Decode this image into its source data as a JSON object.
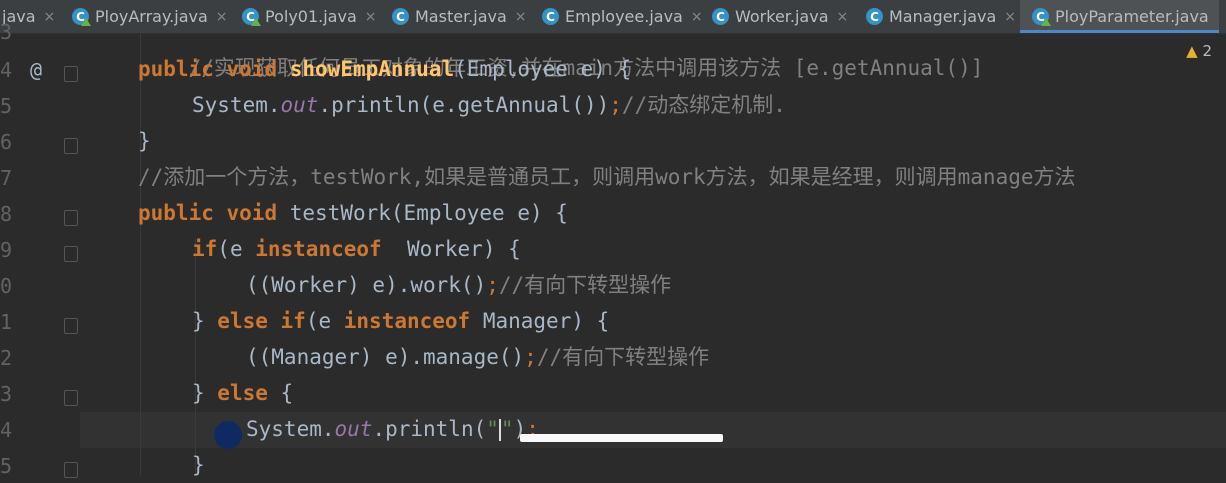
{
  "tabs": [
    {
      "label": "java",
      "icon": "none"
    },
    {
      "label": "PloyArray.java",
      "icon": "class-run-icon"
    },
    {
      "label": "Poly01.java",
      "icon": "class-run-icon"
    },
    {
      "label": "Master.java",
      "icon": "class-icon"
    },
    {
      "label": "Employee.java",
      "icon": "class-icon"
    },
    {
      "label": "Worker.java",
      "icon": "class-icon"
    },
    {
      "label": "Manager.java",
      "icon": "class-icon"
    },
    {
      "label": "PloyParameter.java",
      "icon": "class-run-icon",
      "active": true
    }
  ],
  "close_glyph": "×",
  "inspections": {
    "count": "2"
  },
  "gutter": {
    "line_numbers": [
      "3",
      "4",
      "5",
      "6",
      "7",
      "8",
      "9",
      "0",
      "1",
      "2",
      "3",
      "4",
      "5"
    ],
    "annotation": "@"
  },
  "code": {
    "line0_comment": "//实现获取任何员工对象的年工资,并在main方法中调用该方法 [e.getAnnual()]",
    "line1": {
      "kw1": "public",
      "kw2": "void",
      "name": "showEmpAnnual",
      "sig": "(Employee e) {"
    },
    "line2": {
      "a": "System.",
      "field": "out",
      "b": ".println(e.getAnnual())",
      "semi": ";",
      "comment": "//动态绑定机制."
    },
    "line3": "}",
    "line4_comment": "//添加一个方法，testWork,如果是普通员工，则调用work方法，如果是经理，则调用manage方法",
    "line5": {
      "kw1": "public",
      "kw2": "void",
      "name": "testWork",
      "sig": "(Employee e) {"
    },
    "line6": {
      "kw1": "if",
      "a": "(e ",
      "kw2": "instanceof",
      "b": "  Worker) {"
    },
    "line7": {
      "a": "((Worker) e).work()",
      "semi": ";",
      "comment": "//有向下转型操作"
    },
    "line8": {
      "a": "} ",
      "kw1": "else",
      "sp": " ",
      "kw2": "if",
      "b": "(e ",
      "kw3": "instanceof",
      "c": " Manager) {"
    },
    "line9": {
      "a": "((Manager) e).manage()",
      "semi": ";",
      "comment": "//有向下转型操作"
    },
    "line10": {
      "a": "} ",
      "kw": "else",
      "b": " {"
    },
    "line11": {
      "a": "System.",
      "field": "out",
      "b": ".println(",
      "str_open": "\"",
      "str_close": "\"",
      "c": ")",
      "semi": ";"
    },
    "line12": "}"
  }
}
